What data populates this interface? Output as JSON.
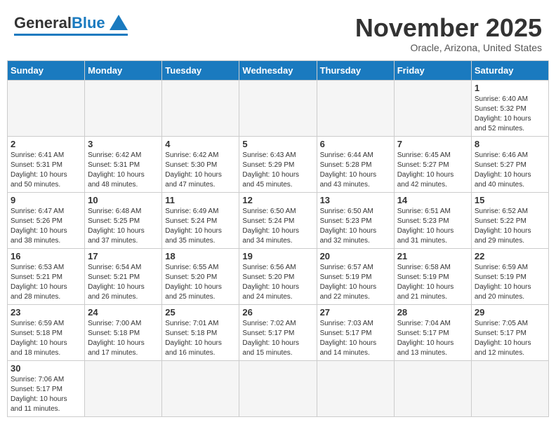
{
  "header": {
    "logo_general": "General",
    "logo_blue": "Blue",
    "month": "November 2025",
    "location": "Oracle, Arizona, United States"
  },
  "weekdays": [
    "Sunday",
    "Monday",
    "Tuesday",
    "Wednesday",
    "Thursday",
    "Friday",
    "Saturday"
  ],
  "days": [
    {
      "num": "",
      "info": "",
      "empty": true
    },
    {
      "num": "",
      "info": "",
      "empty": true
    },
    {
      "num": "",
      "info": "",
      "empty": true
    },
    {
      "num": "",
      "info": "",
      "empty": true
    },
    {
      "num": "",
      "info": "",
      "empty": true
    },
    {
      "num": "",
      "info": "",
      "empty": true
    },
    {
      "num": "1",
      "info": "Sunrise: 6:40 AM\nSunset: 5:32 PM\nDaylight: 10 hours\nand 52 minutes.",
      "empty": false
    },
    {
      "num": "2",
      "info": "Sunrise: 6:41 AM\nSunset: 5:31 PM\nDaylight: 10 hours\nand 50 minutes.",
      "empty": false
    },
    {
      "num": "3",
      "info": "Sunrise: 6:42 AM\nSunset: 5:31 PM\nDaylight: 10 hours\nand 48 minutes.",
      "empty": false
    },
    {
      "num": "4",
      "info": "Sunrise: 6:42 AM\nSunset: 5:30 PM\nDaylight: 10 hours\nand 47 minutes.",
      "empty": false
    },
    {
      "num": "5",
      "info": "Sunrise: 6:43 AM\nSunset: 5:29 PM\nDaylight: 10 hours\nand 45 minutes.",
      "empty": false
    },
    {
      "num": "6",
      "info": "Sunrise: 6:44 AM\nSunset: 5:28 PM\nDaylight: 10 hours\nand 43 minutes.",
      "empty": false
    },
    {
      "num": "7",
      "info": "Sunrise: 6:45 AM\nSunset: 5:27 PM\nDaylight: 10 hours\nand 42 minutes.",
      "empty": false
    },
    {
      "num": "8",
      "info": "Sunrise: 6:46 AM\nSunset: 5:27 PM\nDaylight: 10 hours\nand 40 minutes.",
      "empty": false
    },
    {
      "num": "9",
      "info": "Sunrise: 6:47 AM\nSunset: 5:26 PM\nDaylight: 10 hours\nand 38 minutes.",
      "empty": false
    },
    {
      "num": "10",
      "info": "Sunrise: 6:48 AM\nSunset: 5:25 PM\nDaylight: 10 hours\nand 37 minutes.",
      "empty": false
    },
    {
      "num": "11",
      "info": "Sunrise: 6:49 AM\nSunset: 5:24 PM\nDaylight: 10 hours\nand 35 minutes.",
      "empty": false
    },
    {
      "num": "12",
      "info": "Sunrise: 6:50 AM\nSunset: 5:24 PM\nDaylight: 10 hours\nand 34 minutes.",
      "empty": false
    },
    {
      "num": "13",
      "info": "Sunrise: 6:50 AM\nSunset: 5:23 PM\nDaylight: 10 hours\nand 32 minutes.",
      "empty": false
    },
    {
      "num": "14",
      "info": "Sunrise: 6:51 AM\nSunset: 5:23 PM\nDaylight: 10 hours\nand 31 minutes.",
      "empty": false
    },
    {
      "num": "15",
      "info": "Sunrise: 6:52 AM\nSunset: 5:22 PM\nDaylight: 10 hours\nand 29 minutes.",
      "empty": false
    },
    {
      "num": "16",
      "info": "Sunrise: 6:53 AM\nSunset: 5:21 PM\nDaylight: 10 hours\nand 28 minutes.",
      "empty": false
    },
    {
      "num": "17",
      "info": "Sunrise: 6:54 AM\nSunset: 5:21 PM\nDaylight: 10 hours\nand 26 minutes.",
      "empty": false
    },
    {
      "num": "18",
      "info": "Sunrise: 6:55 AM\nSunset: 5:20 PM\nDaylight: 10 hours\nand 25 minutes.",
      "empty": false
    },
    {
      "num": "19",
      "info": "Sunrise: 6:56 AM\nSunset: 5:20 PM\nDaylight: 10 hours\nand 24 minutes.",
      "empty": false
    },
    {
      "num": "20",
      "info": "Sunrise: 6:57 AM\nSunset: 5:19 PM\nDaylight: 10 hours\nand 22 minutes.",
      "empty": false
    },
    {
      "num": "21",
      "info": "Sunrise: 6:58 AM\nSunset: 5:19 PM\nDaylight: 10 hours\nand 21 minutes.",
      "empty": false
    },
    {
      "num": "22",
      "info": "Sunrise: 6:59 AM\nSunset: 5:19 PM\nDaylight: 10 hours\nand 20 minutes.",
      "empty": false
    },
    {
      "num": "23",
      "info": "Sunrise: 6:59 AM\nSunset: 5:18 PM\nDaylight: 10 hours\nand 18 minutes.",
      "empty": false
    },
    {
      "num": "24",
      "info": "Sunrise: 7:00 AM\nSunset: 5:18 PM\nDaylight: 10 hours\nand 17 minutes.",
      "empty": false
    },
    {
      "num": "25",
      "info": "Sunrise: 7:01 AM\nSunset: 5:18 PM\nDaylight: 10 hours\nand 16 minutes.",
      "empty": false
    },
    {
      "num": "26",
      "info": "Sunrise: 7:02 AM\nSunset: 5:17 PM\nDaylight: 10 hours\nand 15 minutes.",
      "empty": false
    },
    {
      "num": "27",
      "info": "Sunrise: 7:03 AM\nSunset: 5:17 PM\nDaylight: 10 hours\nand 14 minutes.",
      "empty": false
    },
    {
      "num": "28",
      "info": "Sunrise: 7:04 AM\nSunset: 5:17 PM\nDaylight: 10 hours\nand 13 minutes.",
      "empty": false
    },
    {
      "num": "29",
      "info": "Sunrise: 7:05 AM\nSunset: 5:17 PM\nDaylight: 10 hours\nand 12 minutes.",
      "empty": false
    },
    {
      "num": "30",
      "info": "Sunrise: 7:06 AM\nSunset: 5:17 PM\nDaylight: 10 hours\nand 11 minutes.",
      "empty": false
    },
    {
      "num": "",
      "info": "",
      "empty": true
    },
    {
      "num": "",
      "info": "",
      "empty": true
    },
    {
      "num": "",
      "info": "",
      "empty": true
    },
    {
      "num": "",
      "info": "",
      "empty": true
    },
    {
      "num": "",
      "info": "",
      "empty": true
    },
    {
      "num": "",
      "info": "",
      "empty": true
    }
  ]
}
